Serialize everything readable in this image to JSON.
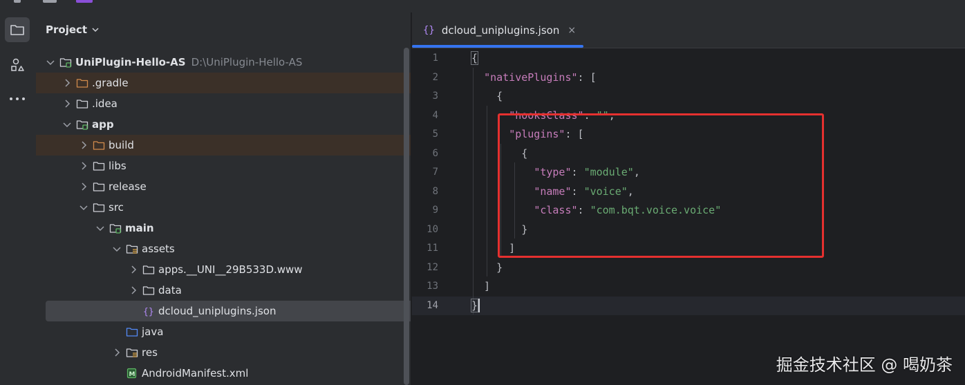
{
  "colors": {
    "accent": "#3574f0",
    "highlight_box": "#e5302f",
    "json_key": "#c77dbb",
    "json_string": "#6aab73",
    "folder_excluded": "#d08a4c",
    "folder_icon": "#ced0d6",
    "json_icon": "#b189f5"
  },
  "toolstrip": {
    "icons": [
      "folder-icon",
      "structure-icon",
      "more-icon"
    ]
  },
  "project": {
    "header_label": "Project",
    "tree": [
      {
        "label": "UniPlugin-Hello-AS",
        "path": "D:\\UniPlugin-Hello-AS",
        "depth": 0,
        "expanded": true,
        "icon": "module-folder-icon",
        "bold": true,
        "excluded": false,
        "selected": false
      },
      {
        "label": ".gradle",
        "path": "",
        "depth": 1,
        "expanded": false,
        "icon": "excluded-folder-icon",
        "bold": false,
        "excluded": true,
        "selected": false
      },
      {
        "label": ".idea",
        "path": "",
        "depth": 1,
        "expanded": false,
        "icon": "folder-icon",
        "bold": false,
        "excluded": false,
        "selected": false
      },
      {
        "label": "app",
        "path": "",
        "depth": 1,
        "expanded": true,
        "icon": "module-folder-icon",
        "bold": true,
        "excluded": false,
        "selected": false
      },
      {
        "label": "build",
        "path": "",
        "depth": 2,
        "expanded": false,
        "icon": "excluded-folder-icon",
        "bold": false,
        "excluded": true,
        "selected": false
      },
      {
        "label": "libs",
        "path": "",
        "depth": 2,
        "expanded": false,
        "icon": "folder-icon",
        "bold": false,
        "excluded": false,
        "selected": false
      },
      {
        "label": "release",
        "path": "",
        "depth": 2,
        "expanded": false,
        "icon": "folder-icon",
        "bold": false,
        "excluded": false,
        "selected": false
      },
      {
        "label": "src",
        "path": "",
        "depth": 2,
        "expanded": true,
        "icon": "folder-icon",
        "bold": false,
        "excluded": false,
        "selected": false
      },
      {
        "label": "main",
        "path": "",
        "depth": 3,
        "expanded": true,
        "icon": "module-folder-icon",
        "bold": true,
        "excluded": false,
        "selected": false
      },
      {
        "label": "assets",
        "path": "",
        "depth": 4,
        "expanded": true,
        "icon": "resource-folder-icon",
        "bold": false,
        "excluded": false,
        "selected": false
      },
      {
        "label": "apps.__UNI__29B533D.www",
        "path": "",
        "depth": 5,
        "expanded": false,
        "icon": "folder-icon",
        "bold": false,
        "excluded": false,
        "selected": false
      },
      {
        "label": "data",
        "path": "",
        "depth": 5,
        "expanded": false,
        "icon": "folder-icon",
        "bold": false,
        "excluded": false,
        "selected": false
      },
      {
        "label": "dcloud_uniplugins.json",
        "path": "",
        "depth": 5,
        "expanded": null,
        "icon": "json-file-icon",
        "bold": false,
        "excluded": false,
        "selected": true
      },
      {
        "label": "java",
        "path": "",
        "depth": 4,
        "expanded": null,
        "icon": "source-folder-icon",
        "bold": false,
        "excluded": false,
        "selected": false
      },
      {
        "label": "res",
        "path": "",
        "depth": 4,
        "expanded": false,
        "icon": "resource-folder-icon",
        "bold": false,
        "excluded": false,
        "selected": false
      },
      {
        "label": "AndroidManifest.xml",
        "path": "",
        "depth": 4,
        "expanded": null,
        "icon": "manifest-file-icon",
        "bold": false,
        "excluded": false,
        "selected": false
      }
    ]
  },
  "editor": {
    "tab": {
      "label": "dcloud_uniplugins.json",
      "icon_glyph": "{}",
      "close_glyph": "×"
    },
    "current_line": 14,
    "lines": [
      [
        {
          "t": "p",
          "v": "{"
        }
      ],
      [
        {
          "t": "p",
          "v": "  "
        },
        {
          "t": "k",
          "v": "\"nativePlugins\""
        },
        {
          "t": "p",
          "v": ": ["
        }
      ],
      [
        {
          "t": "p",
          "v": "    {"
        }
      ],
      [
        {
          "t": "p",
          "v": "      "
        },
        {
          "t": "k",
          "v": "\"hooksClass\""
        },
        {
          "t": "p",
          "v": ": "
        },
        {
          "t": "s",
          "v": "\"\""
        },
        {
          "t": "p",
          "v": ","
        }
      ],
      [
        {
          "t": "p",
          "v": "      "
        },
        {
          "t": "k",
          "v": "\"plugins\""
        },
        {
          "t": "p",
          "v": ": ["
        }
      ],
      [
        {
          "t": "p",
          "v": "        {"
        }
      ],
      [
        {
          "t": "p",
          "v": "          "
        },
        {
          "t": "k",
          "v": "\"type\""
        },
        {
          "t": "p",
          "v": ": "
        },
        {
          "t": "s",
          "v": "\"module\""
        },
        {
          "t": "p",
          "v": ","
        }
      ],
      [
        {
          "t": "p",
          "v": "          "
        },
        {
          "t": "k",
          "v": "\"name\""
        },
        {
          "t": "p",
          "v": ": "
        },
        {
          "t": "s",
          "v": "\"voice\""
        },
        {
          "t": "p",
          "v": ","
        }
      ],
      [
        {
          "t": "p",
          "v": "          "
        },
        {
          "t": "k",
          "v": "\"class\""
        },
        {
          "t": "p",
          "v": ": "
        },
        {
          "t": "s",
          "v": "\"com.bqt.voice.voice\""
        }
      ],
      [
        {
          "t": "p",
          "v": "        }"
        }
      ],
      [
        {
          "t": "p",
          "v": "      ]"
        }
      ],
      [
        {
          "t": "p",
          "v": "    }"
        }
      ],
      [
        {
          "t": "p",
          "v": "  ]"
        }
      ],
      [
        {
          "t": "p",
          "v": "}"
        }
      ]
    ]
  },
  "watermark": "掘金技术社区 @ 喝奶茶"
}
